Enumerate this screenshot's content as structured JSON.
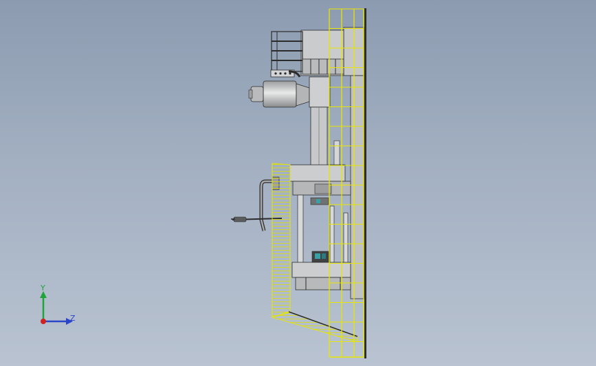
{
  "view": {
    "background_top": "#8c9bb0",
    "background_bottom": "#b9c3d1",
    "model_fill": "#c9cbcc",
    "model_edge": "#2b2b2b",
    "ladder_color": "#e6e600"
  },
  "triad": {
    "y_label": "Y",
    "z_label": "Z",
    "y_color": "#1fa43a",
    "z_color": "#2b45c8",
    "x_color": "#d02020"
  }
}
